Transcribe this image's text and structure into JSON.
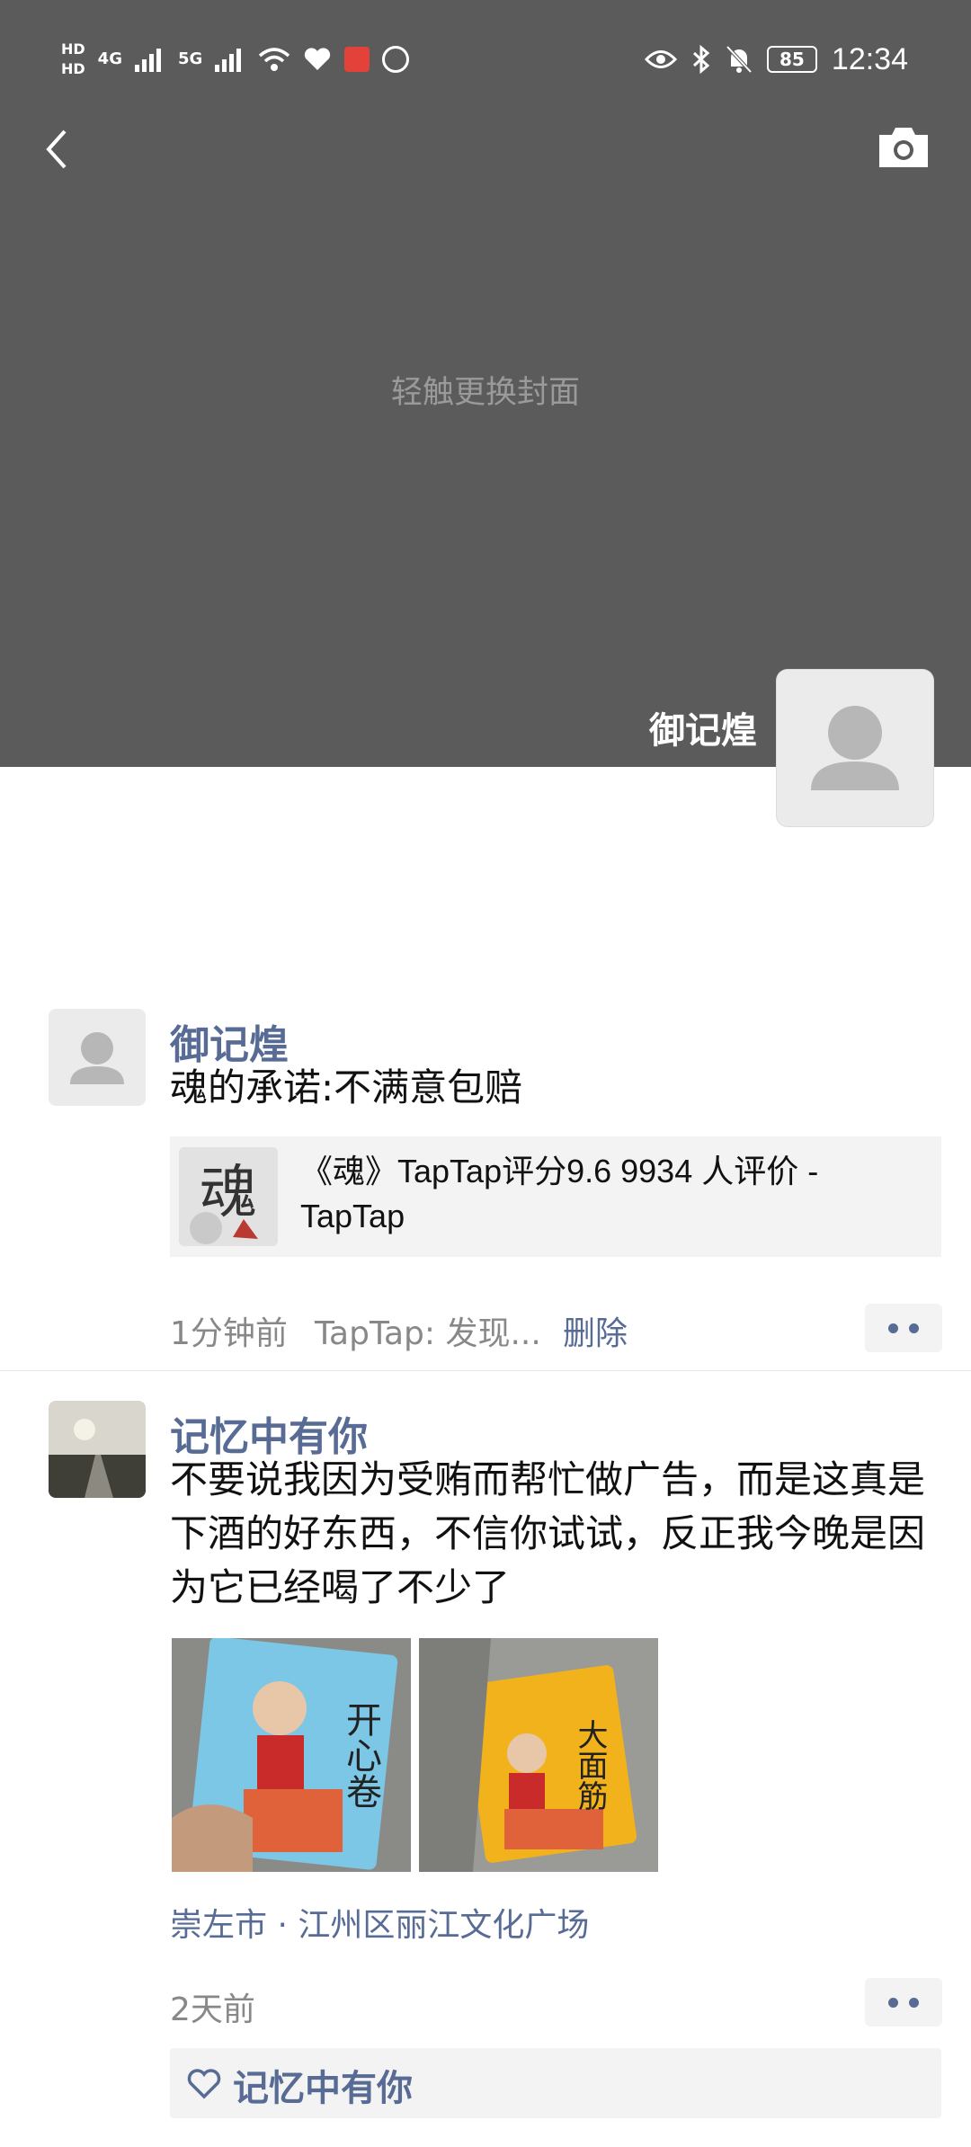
{
  "status_bar": {
    "hd1": "HD",
    "hd2": "HD",
    "net1": "4G",
    "net2": "5G",
    "battery": "85",
    "time": "12:34"
  },
  "cover": {
    "hint": "轻触更换封面",
    "profile_name": "御记煌"
  },
  "posts": [
    {
      "author": "御记煌",
      "text": "魂的承诺:不满意包赔",
      "link": {
        "title": "《魂》TapTap评分9.6 9934 人评价 - TapTap",
        "thumb_glyph": "魂"
      },
      "time": "1分钟前",
      "source": "TapTap: 发现...",
      "delete_label": "删除"
    },
    {
      "author": "记忆中有你",
      "text": "不要说我因为受贿而帮忙做广告，而是这真是下酒的好东西，不信你试试，反正我今晚是因为它已经喝了不少了",
      "photos": [
        {
          "label": "开心卷",
          "alt": "snack-pack-blue"
        },
        {
          "label": "大面筋",
          "alt": "snack-pack-yellow"
        }
      ],
      "location": "崇左市 · 江州区丽江文化广场",
      "time": "2天前",
      "likes": [
        "记忆中有你"
      ]
    }
  ],
  "colors": {
    "cover_bg": "#5b5b5b",
    "link_blue": "#576b95",
    "meta_gray": "#888888",
    "card_bg": "#f3f3f3"
  }
}
